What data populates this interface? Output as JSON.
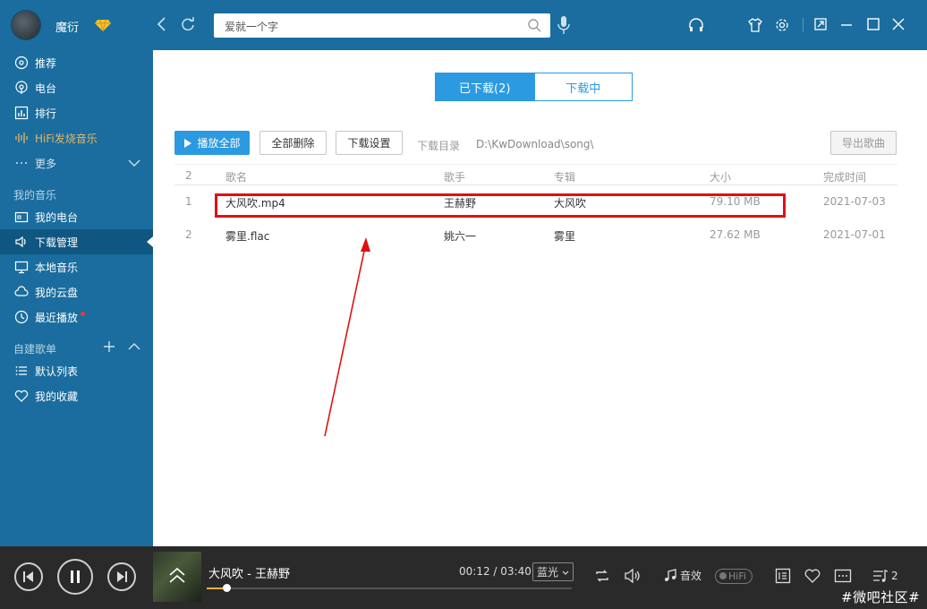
{
  "app": {
    "username": "魔衍",
    "accent": "#1a6d9e"
  },
  "search": {
    "text": "爱就一个字"
  },
  "sidebar": {
    "items": [
      {
        "label": "推荐",
        "icon": "disc-icon"
      },
      {
        "label": "电台",
        "icon": "radio-icon"
      },
      {
        "label": "排行",
        "icon": "chart-icon"
      },
      {
        "label": "HiFi发烧音乐",
        "icon": "wave-icon"
      },
      {
        "label": "更多",
        "icon": "dots-icon"
      }
    ],
    "my_music_title": "我的音乐",
    "my_music": [
      {
        "label": "我的电台",
        "icon": "tv-icon"
      },
      {
        "label": "下载管理",
        "icon": "speaker-icon"
      },
      {
        "label": "本地音乐",
        "icon": "monitor-icon"
      },
      {
        "label": "我的云盘",
        "icon": "cloud-icon"
      },
      {
        "label": "最近播放",
        "icon": "clock-icon"
      }
    ],
    "playlist_title": "自建歌单",
    "playlists": [
      {
        "label": "默认列表",
        "icon": "list-icon"
      },
      {
        "label": "我的收藏",
        "icon": "heart-icon"
      }
    ]
  },
  "main": {
    "tabs": [
      {
        "label": "已下载(2)"
      },
      {
        "label": "下载中"
      }
    ],
    "toolbar": {
      "play_all": "播放全部",
      "delete_all": "全部删除",
      "settings": "下载设置",
      "dir_label": "下载目录",
      "dir_path": "D:\\KwDownload\\song\\",
      "export": "导出歌曲"
    },
    "table": {
      "headers": {
        "num": "2",
        "name": "歌名",
        "artist": "歌手",
        "album": "专辑",
        "size": "大小",
        "date": "完成时间"
      },
      "rows": [
        {
          "num": "1",
          "name": "大风吹.mp4",
          "artist": "王赫野",
          "album": "大风吹",
          "size": "79.10 MB",
          "date": "2021-07-03"
        },
        {
          "num": "2",
          "name": "雾里.flac",
          "artist": "姚六一",
          "album": "雾里",
          "size": "27.62 MB",
          "date": "2021-07-01"
        }
      ]
    }
  },
  "player": {
    "title": "大风吹 - 王赫野",
    "time": "00:12 / 03:40",
    "progress": 0.055,
    "quality": "蓝光",
    "effect": "音效",
    "hifi": "HiFi",
    "queue_count": "2"
  },
  "watermark": "#微吧社区#"
}
